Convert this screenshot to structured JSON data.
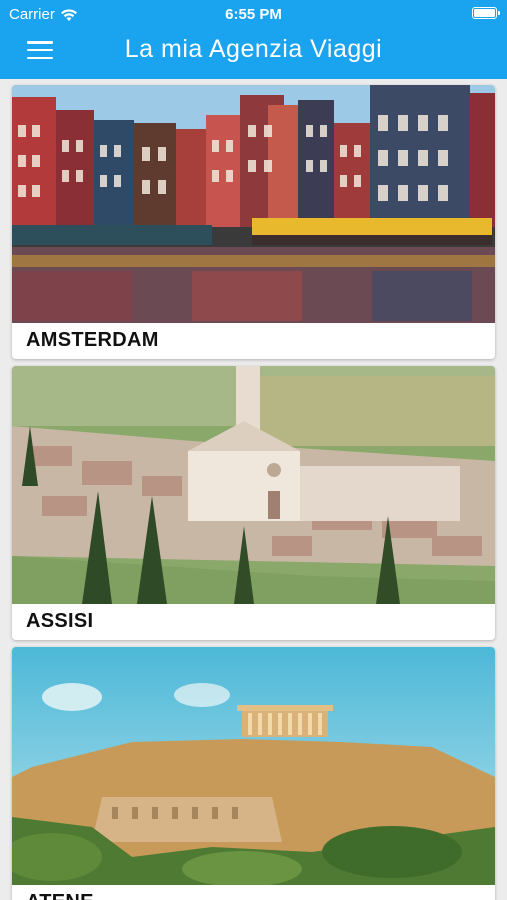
{
  "status_bar": {
    "carrier": "Carrier",
    "time": "6:55 PM"
  },
  "header": {
    "title": "La mia Agenzia Viaggi",
    "menu_icon": "hamburger-menu-icon"
  },
  "colors": {
    "accent": "#1aa3ee"
  },
  "destinations": [
    {
      "name": "AMSTERDAM"
    },
    {
      "name": "ASSISI"
    },
    {
      "name": "ATENE"
    }
  ]
}
